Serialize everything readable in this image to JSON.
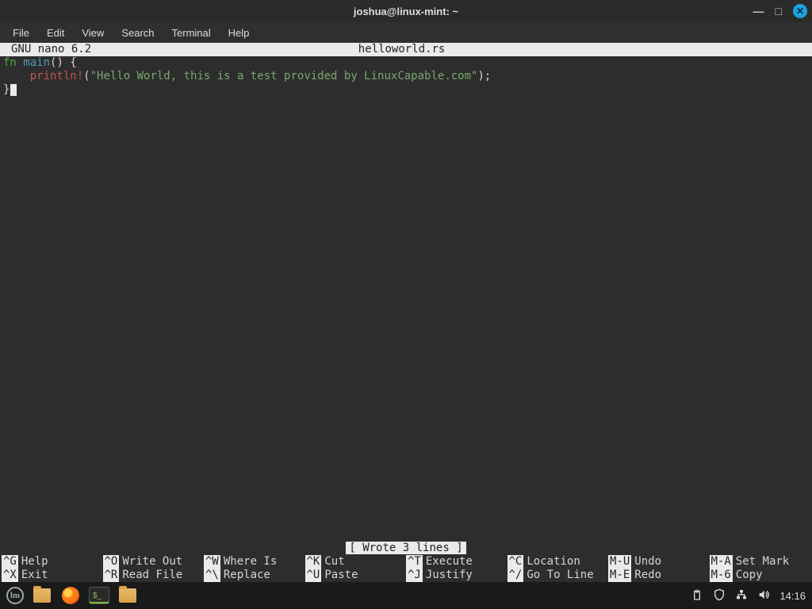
{
  "titlebar": {
    "title": "joshua@linux-mint: ~"
  },
  "menubar": [
    "File",
    "Edit",
    "View",
    "Search",
    "Terminal",
    "Help"
  ],
  "nano": {
    "app": "GNU nano 6.2",
    "filename": "helloworld.rs",
    "code": {
      "line1_kw": "fn",
      "line1_name": "main",
      "line1_rest": "() {",
      "line2_indent": "    ",
      "line2_call": "println!",
      "line2_paren_open": "(",
      "line2_str": "\"Hello World, this is a test provided by LinuxCapable.com\"",
      "line2_paren_close": ");",
      "line3": "}"
    },
    "status": "[ Wrote 3 lines ]",
    "shortcuts": [
      {
        "k": "^G",
        "t": "Help"
      },
      {
        "k": "^O",
        "t": "Write Out"
      },
      {
        "k": "^W",
        "t": "Where Is"
      },
      {
        "k": "^K",
        "t": "Cut"
      },
      {
        "k": "^T",
        "t": "Execute"
      },
      {
        "k": "^C",
        "t": "Location"
      },
      {
        "k": "M-U",
        "t": "Undo"
      },
      {
        "k": "M-A",
        "t": "Set Mark"
      },
      {
        "k": "^X",
        "t": "Exit"
      },
      {
        "k": "^R",
        "t": "Read File"
      },
      {
        "k": "^\\",
        "t": "Replace"
      },
      {
        "k": "^U",
        "t": "Paste"
      },
      {
        "k": "^J",
        "t": "Justify"
      },
      {
        "k": "^/",
        "t": "Go To Line"
      },
      {
        "k": "M-E",
        "t": "Redo"
      },
      {
        "k": "M-6",
        "t": "Copy"
      }
    ],
    "shortcut_layout": [
      [
        0,
        1,
        2,
        3,
        4,
        5,
        6,
        7
      ],
      [
        8,
        9,
        10,
        11,
        12,
        13,
        14,
        15
      ]
    ]
  },
  "taskbar": {
    "clock": "14:16"
  }
}
